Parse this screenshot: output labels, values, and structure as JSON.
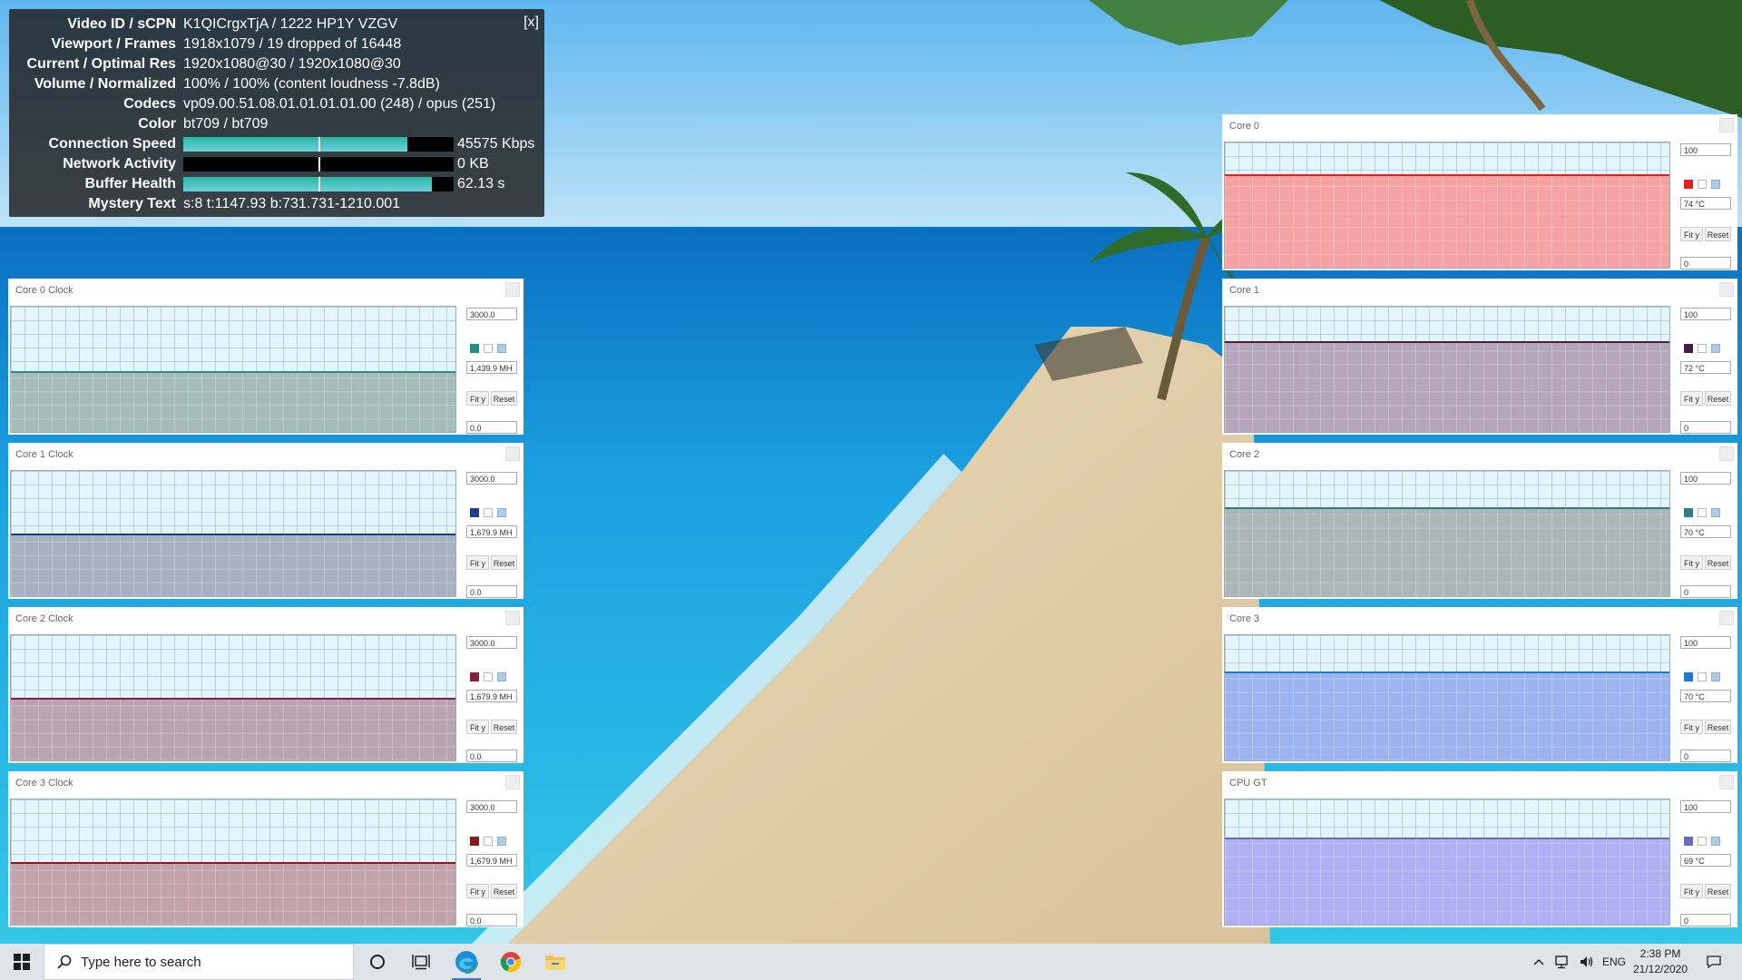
{
  "stats": {
    "close_label": "[x]",
    "rows": [
      {
        "label": "Video ID / sCPN",
        "value": "K1QICrgxTjA / 1222 HP1Y VZGV"
      },
      {
        "label": "Viewport / Frames",
        "value": "1918x1079 / 19 dropped of 16448"
      },
      {
        "label": "Current / Optimal Res",
        "value": "1920x1080@30 / 1920x1080@30"
      },
      {
        "label": "Volume / Normalized",
        "value": "100% / 100% (content loudness -7.8dB)"
      },
      {
        "label": "Codecs",
        "value": "vp09.00.51.08.01.01.01.01.00 (248) / opus (251)"
      },
      {
        "label": "Color",
        "value": "bt709 / bt709"
      },
      {
        "label": "Connection Speed",
        "value": "45575 Kbps",
        "bar_level": 0.83
      },
      {
        "label": "Network Activity",
        "value": "0 KB",
        "bar_level": 0.0
      },
      {
        "label": "Buffer Health",
        "value": "62.13 s",
        "bar_level": 0.92
      },
      {
        "label": "Mystery Text",
        "value": "s:8 t:1147.93 b:731.731-1210.001"
      }
    ]
  },
  "monitors": {
    "fit_label": "Fit y",
    "reset_label": "Reset",
    "clock": [
      {
        "title": "Core 0 Clock",
        "max": "3000.0",
        "current": "1,439.9 MH",
        "min": "0.0",
        "level": 0.48,
        "color": "#1f8f8f",
        "fill": "#a5bdb8"
      },
      {
        "title": "Core 1 Clock",
        "max": "3000.0",
        "current": "1,679.9 MH",
        "min": "0.0",
        "level": 0.49,
        "color": "#1c3c8c",
        "fill": "#a8b1c2"
      },
      {
        "title": "Core 2 Clock",
        "max": "3000.0",
        "current": "1,679.9 MH",
        "min": "0.0",
        "level": 0.49,
        "color": "#8b1a4a",
        "fill": "#bca3b3"
      },
      {
        "title": "Core 3 Clock",
        "max": "3000.0",
        "current": "1,679.9 MH",
        "min": "0.0",
        "level": 0.49,
        "color": "#8b1a1a",
        "fill": "#c2a3ab"
      }
    ],
    "temp": [
      {
        "title": "Core 0",
        "max": "100",
        "current": "74 °C",
        "min": "0",
        "level": 0.74,
        "color": "#e02020",
        "fill": "#f6a3a3"
      },
      {
        "title": "Core 1",
        "max": "100",
        "current": "72 °C",
        "min": "0",
        "level": 0.72,
        "color": "#4a1a4a",
        "fill": "#b5a6bc"
      },
      {
        "title": "Core 2",
        "max": "100",
        "current": "70 °C",
        "min": "0",
        "level": 0.7,
        "color": "#2f7f7f",
        "fill": "#aab6b8"
      },
      {
        "title": "Core 3",
        "max": "100",
        "current": "70 °C",
        "min": "0",
        "level": 0.7,
        "color": "#1a7ad0",
        "fill": "#9bb4ef"
      },
      {
        "title": "CPU GT",
        "max": "100",
        "current": "69 °C",
        "min": "0",
        "level": 0.69,
        "color": "#6a6ac0",
        "fill": "#b0b0f4"
      }
    ]
  },
  "taskbar": {
    "search_placeholder": "Type here to search",
    "language": "ENG",
    "time": "2:38 PM",
    "date": "21/12/2020"
  }
}
